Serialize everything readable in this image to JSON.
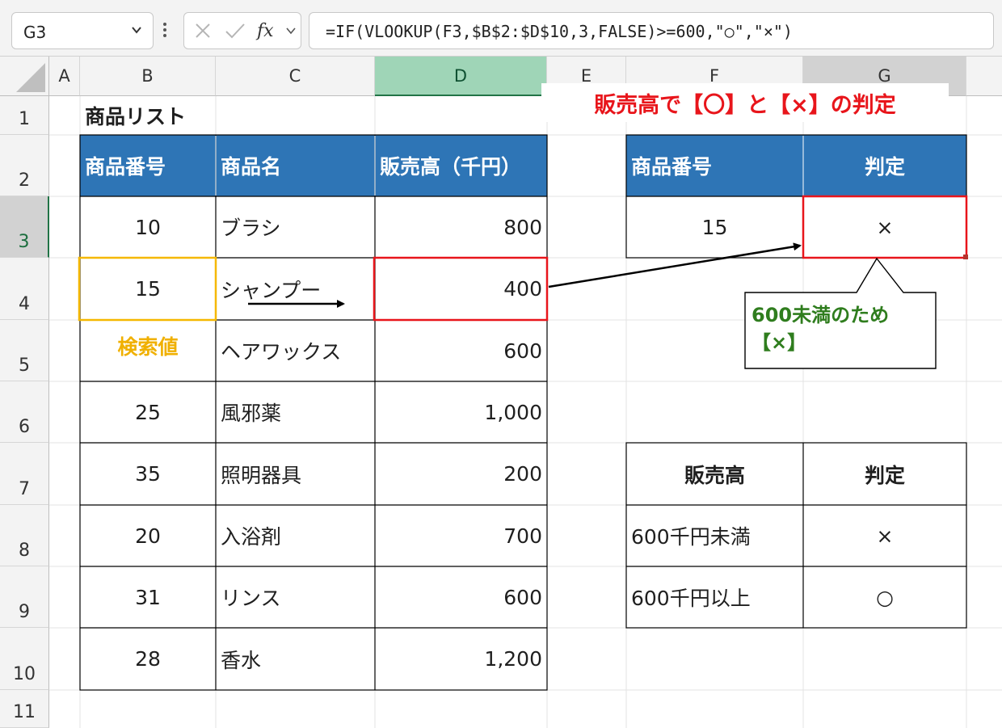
{
  "formula_bar": {
    "name_box": "G3",
    "formula": "=IF(VLOOKUP(F3,$B$2:$D$10,3,FALSE)>=600,\"○\",\"×\")"
  },
  "columns": [
    "A",
    "B",
    "C",
    "D",
    "E",
    "F",
    "G"
  ],
  "rows": [
    "1",
    "2",
    "3",
    "4",
    "5",
    "6",
    "7",
    "8",
    "9",
    "10",
    "11"
  ],
  "selected_column": "D",
  "active_cell": "G3",
  "product_list": {
    "title": "商品リスト",
    "headers": [
      "商品番号",
      "商品名",
      "販売高（千円）"
    ],
    "rows": [
      [
        "10",
        "ブラシ",
        "800"
      ],
      [
        "15",
        "シャンプー",
        "400"
      ],
      [
        "",
        "ヘアワックス",
        "600"
      ],
      [
        "25",
        "風邪薬",
        "1,000"
      ],
      [
        "35",
        "照明器具",
        "200"
      ],
      [
        "20",
        "入浴剤",
        "700"
      ],
      [
        "31",
        "リンス",
        "600"
      ],
      [
        "28",
        "香水",
        "1,200"
      ]
    ],
    "search_value_label": "検索値"
  },
  "lookup_table": {
    "headers": [
      "商品番号",
      "判定"
    ],
    "product_no": "15",
    "result": "×"
  },
  "criteria_table": {
    "headers": [
      "販売高",
      "判定"
    ],
    "rows": [
      [
        "600千円未満",
        "×"
      ],
      [
        "600千円以上",
        "○"
      ]
    ]
  },
  "annotations": {
    "title": "販売高で【〇】と【×】の判定",
    "callout_line1": "600未満のため",
    "callout_line2": "【×】"
  },
  "colors": {
    "header_blue": "#2e75b6",
    "annotation_red": "#e8151b",
    "callout_green": "#2f7d1e",
    "search_yellow": "#f0b000",
    "excel_green": "#217346"
  }
}
